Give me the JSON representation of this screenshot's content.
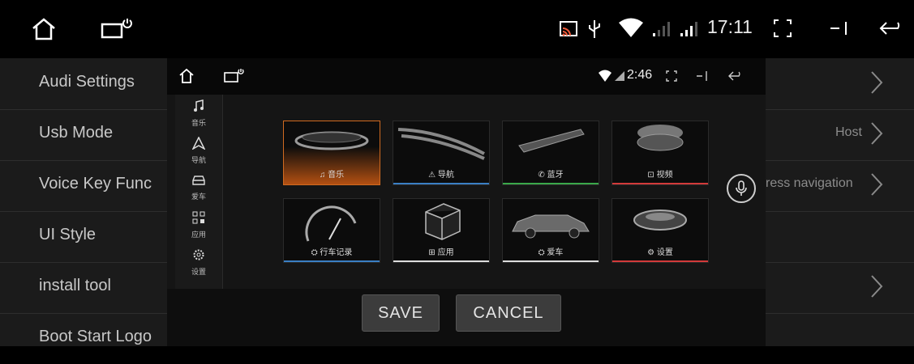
{
  "status_bar": {
    "time": "17:11",
    "icons": [
      "home-icon",
      "recent-apps-icon",
      "cast-icon",
      "usb-icon",
      "wifi-icon",
      "signal-icon",
      "signal-icon",
      "screenshot-icon",
      "split-screen-icon",
      "back-icon"
    ]
  },
  "settings": {
    "rows": [
      {
        "label": "Audi Settings",
        "value": ""
      },
      {
        "label": "Usb Mode",
        "value": "Host"
      },
      {
        "label": "Voice Key Func",
        "value": "ress navigation"
      },
      {
        "label": "UI Style",
        "value": ""
      },
      {
        "label": "install tool",
        "value": ""
      },
      {
        "label": "Boot Start Logo",
        "value": ""
      }
    ]
  },
  "dialog": {
    "status_time": "2:46",
    "sidebar": [
      {
        "icon": "music-note-icon",
        "caption": "音乐"
      },
      {
        "icon": "navigation-icon",
        "caption": "导航"
      },
      {
        "icon": "car-icon",
        "caption": "爱车"
      },
      {
        "icon": "apps-grid-icon",
        "caption": "应用"
      },
      {
        "icon": "gear-icon",
        "caption": "设置"
      }
    ],
    "tiles": [
      {
        "label": "♫ 音乐",
        "icon": "music-note-icon",
        "accent": "#e0701f",
        "selected": true
      },
      {
        "label": "⚠ 导航",
        "icon": "navigation-icon",
        "accent": "#3a7fc4"
      },
      {
        "label": "✆ 蓝牙",
        "icon": "bluetooth-phone-icon",
        "accent": "#3aa84a"
      },
      {
        "label": "⊡ 视频",
        "icon": "video-icon",
        "accent": "#d23a3a"
      },
      {
        "label": "⛭ 行车记录",
        "icon": "dvr-icon",
        "accent": "#3a7fc4"
      },
      {
        "label": "⊞ 应用",
        "icon": "apps-icon",
        "accent": "#dddddd"
      },
      {
        "label": "⛭ 爱车",
        "icon": "car-icon",
        "accent": "#dddddd"
      },
      {
        "label": "⚙ 设置",
        "icon": "gear-icon",
        "accent": "#d23a3a"
      }
    ],
    "buttons": {
      "save": "SAVE",
      "cancel": "CANCEL"
    }
  }
}
